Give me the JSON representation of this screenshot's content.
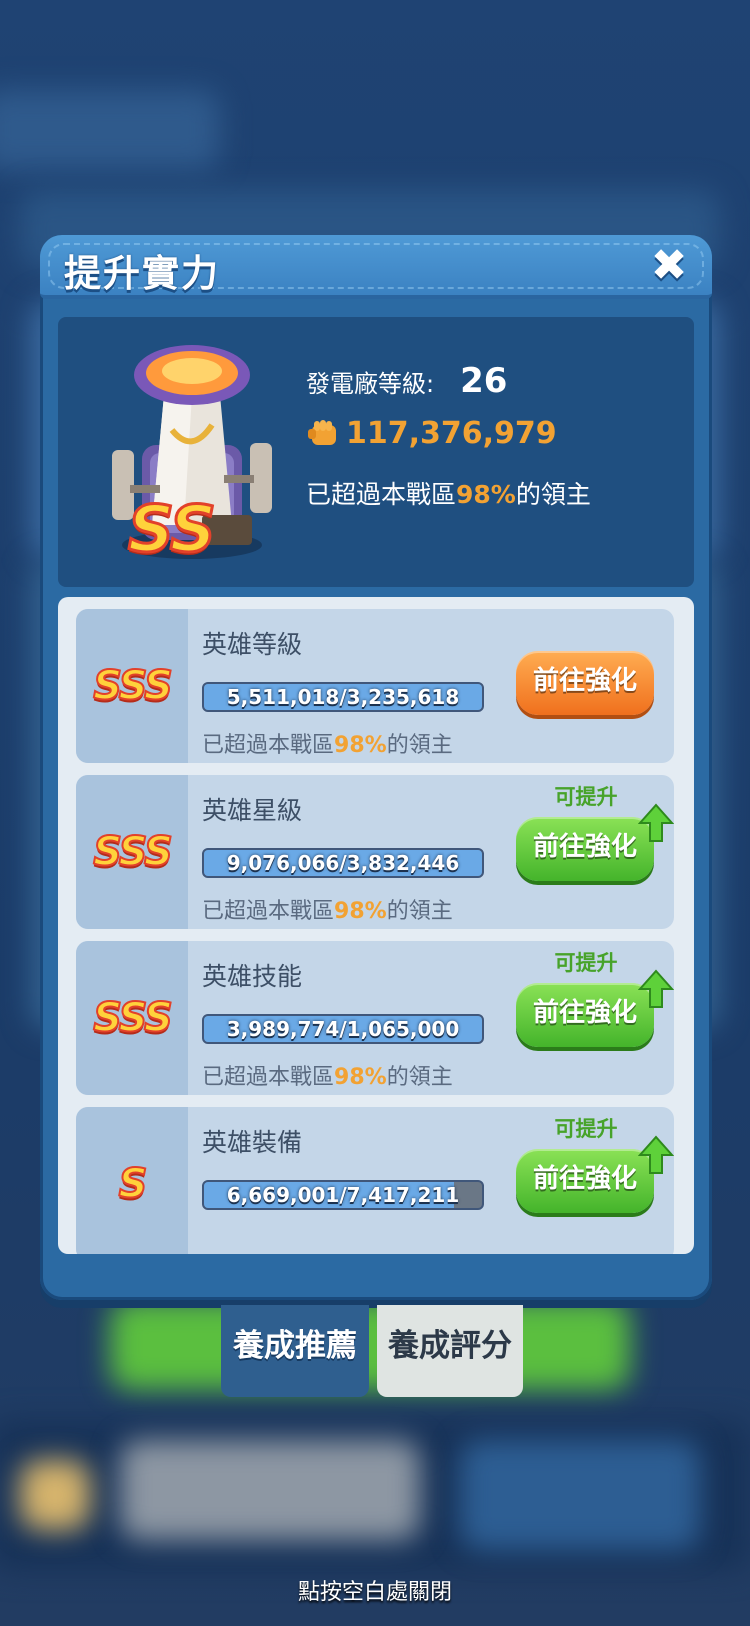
{
  "panel": {
    "title": "提升實力",
    "close_icon": "close-x-icon"
  },
  "power": {
    "plant_label": "發電廠等級:",
    "plant_level": "26",
    "power_icon": "fist-icon",
    "power_value": "117,376,979",
    "rank_prefix": "已超過本戰區",
    "rank_percent": "98%",
    "rank_suffix": "的領主",
    "building_grade": "SS"
  },
  "cards": [
    {
      "grade": "SSS",
      "name": "英雄等級",
      "progress_text": "5,511,018/3,235,618",
      "progress_ratio": 1.0,
      "rank_prefix": "已超過本戰區",
      "rank_percent": "98%",
      "rank_suffix": "的領主",
      "button_label": "前往強化",
      "button_style": "orange",
      "upgradable_label": ""
    },
    {
      "grade": "SSS",
      "name": "英雄星級",
      "progress_text": "9,076,066/3,832,446",
      "progress_ratio": 1.0,
      "rank_prefix": "已超過本戰區",
      "rank_percent": "98%",
      "rank_suffix": "的領主",
      "button_label": "前往強化",
      "button_style": "green",
      "upgradable_label": "可提升"
    },
    {
      "grade": "SSS",
      "name": "英雄技能",
      "progress_text": "3,989,774/1,065,000",
      "progress_ratio": 1.0,
      "rank_prefix": "已超過本戰區",
      "rank_percent": "98%",
      "rank_suffix": "的領主",
      "button_label": "前往強化",
      "button_style": "green",
      "upgradable_label": "可提升"
    },
    {
      "grade": "S",
      "name": "英雄裝備",
      "progress_text": "6,669,001/7,417,211",
      "progress_ratio": 0.9,
      "button_label": "前往強化",
      "button_style": "green",
      "upgradable_label": "可提升"
    }
  ],
  "tabs": {
    "active": "養成推薦",
    "inactive": "養成評分"
  },
  "close_hint": "點按空白處關閉",
  "colors": {
    "highlight": "#f2a233",
    "upgradable": "#47a32a"
  }
}
